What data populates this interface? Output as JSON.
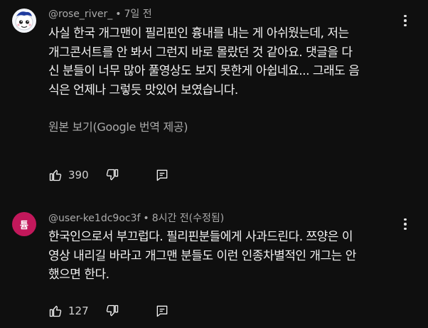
{
  "comments": [
    {
      "author": "@rose_river_",
      "separator": "•",
      "timestamp": "7일 전",
      "text": "사실 한국 개그맨이 필리핀인 흉내를 내는 게 아쉬웠는데, 저는\n개그콘서트를 안 봐서 그런지 바로 몰랐던 것 같아요. 댓글을 다\n신 분들이 너무 많아 풀영상도 보지 못한게 아쉽네요... 그래도 음\n식은 언제나 그렇듯 맛있어 보였습니다.",
      "translate_label": "원본 보기(Google 번역 제공)",
      "like_count": "390",
      "avatar_icon": "cartoon-character-avatar"
    },
    {
      "author": "@user-ke1dc9oc3f",
      "separator": "•",
      "timestamp": "8시간 전(수정됨)",
      "text": "한국인으로서 부끄럽다. 필리핀분들에게 사과드린다.  쯔양은 이\n영상 내리길 바라고 개그맨 분들도 이런 인종차별적인 개그는 안\n했으면 한다.",
      "avatar_letter": "튬",
      "avatar_color": "#c2185b",
      "like_count": "127"
    }
  ],
  "icons": {
    "like": "thumbs-up-icon",
    "dislike": "thumbs-down-icon",
    "reply": "reply-icon",
    "more": "more-options-icon"
  },
  "colors": {
    "background": "#0f0f0f",
    "primary_text": "#f1f1f1",
    "secondary_text": "#aaaaaa"
  }
}
